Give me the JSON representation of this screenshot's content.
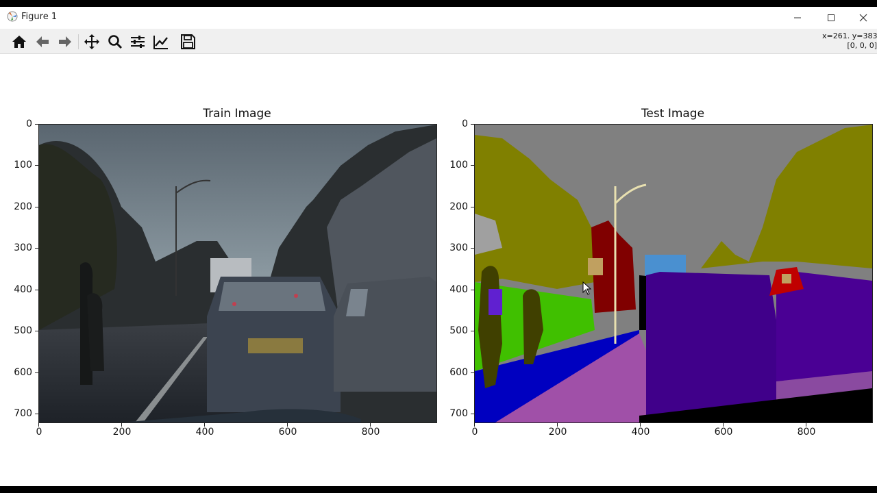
{
  "window": {
    "title": "Figure 1",
    "minimize_icon": "minimize-icon",
    "maximize_icon": "maximize-icon",
    "close_icon": "close-icon"
  },
  "toolbar": {
    "buttons": [
      {
        "name": "home",
        "icon": "home-icon"
      },
      {
        "name": "back",
        "icon": "arrow-left-icon"
      },
      {
        "name": "forward",
        "icon": "arrow-right-icon"
      },
      {
        "name": "pan",
        "icon": "move-icon"
      },
      {
        "name": "zoom",
        "icon": "magnifier-icon"
      },
      {
        "name": "configure-subplots",
        "icon": "sliders-icon"
      },
      {
        "name": "edit-axis",
        "icon": "line-chart-icon"
      },
      {
        "name": "save",
        "icon": "save-icon"
      }
    ],
    "coords_line1": "x=261. y=383",
    "coords_line2": "[0, 0, 0]"
  },
  "figure": {
    "left": {
      "title": "Train Image",
      "yticks": [
        "0",
        "100",
        "200",
        "300",
        "400",
        "500",
        "600",
        "700"
      ],
      "xticks": [
        "0",
        "200",
        "400",
        "600",
        "800"
      ]
    },
    "right": {
      "title": "Test Image",
      "yticks": [
        "0",
        "100",
        "200",
        "300",
        "400",
        "500",
        "600",
        "700"
      ],
      "xticks": [
        "0",
        "200",
        "400",
        "600",
        "800"
      ]
    }
  },
  "colors": {
    "sky": "#808080",
    "vegetation": "#808000",
    "building": "#800000",
    "car": "#40008a",
    "road": "#80408a",
    "sidewalk": "#0000c0",
    "pedestrian": "#404000",
    "fence": "#40c000",
    "sign": "#c0a060",
    "truck": "#4080c0"
  }
}
